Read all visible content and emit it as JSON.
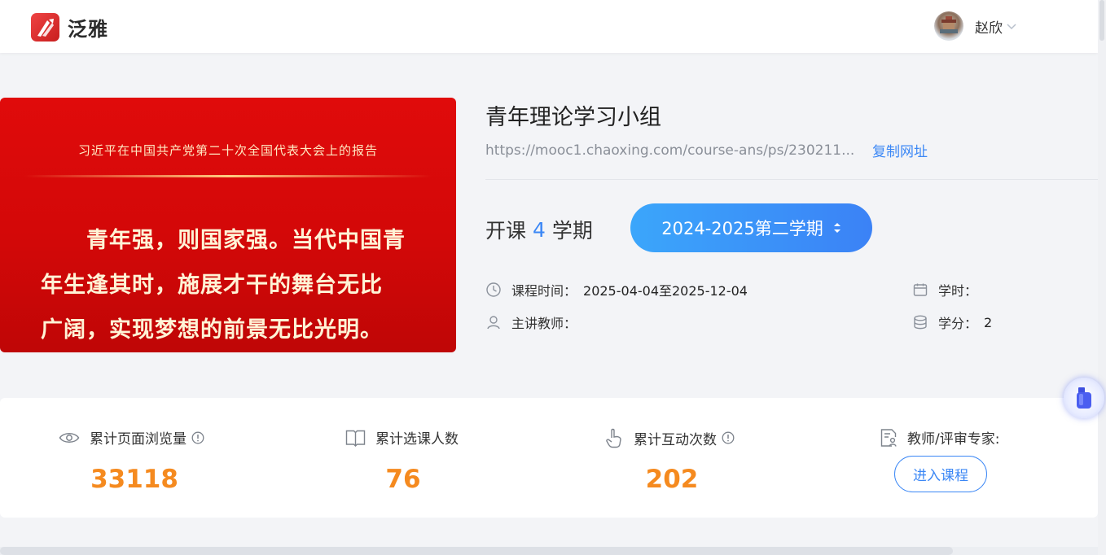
{
  "header": {
    "brand": "泛雅",
    "user_name": "赵欣"
  },
  "banner": {
    "heading": "习近平在中国共产党第二十次全国代表大会上的报告",
    "line1": "青年强，则国家强。当代中国青",
    "line2": "年生逢其时，施展才干的舞台无比",
    "line3": "广阔，实现梦想的前景无比光明。"
  },
  "course": {
    "title": "青年理论学习小组",
    "url": "https://mooc1.chaoxing.com/course-ans/ps/230211...",
    "copy_label": "复制网址",
    "term_prefix": "开课",
    "term_count": "4",
    "term_suffix": "学期",
    "term_selected": "2024-2025第二学期",
    "time_label": "课程时间：",
    "time_value": "2025-04-04至2025-12-04",
    "teacher_label": "主讲教师：",
    "hours_label": "学时：",
    "credit_label": "学分：",
    "credit_value": "2"
  },
  "stats": {
    "views_label": "累计页面浏览量",
    "views_value": "33118",
    "students_label": "累计选课人数",
    "students_value": "76",
    "interactions_label": "累计互动次数",
    "interactions_value": "202",
    "expert_label": "教师/评审专家:",
    "enter_label": "进入课程"
  },
  "colors": {
    "accent": "#3b87f5",
    "stat": "#f58a1f",
    "banner": "#d30808"
  },
  "icons": [
    "clock-icon",
    "calendar-icon",
    "user-icon",
    "coins-icon",
    "eye-icon",
    "book-icon",
    "hand-tap-icon",
    "info-icon",
    "expert-doc-icon",
    "chevron-down-icon",
    "updown-icon"
  ]
}
